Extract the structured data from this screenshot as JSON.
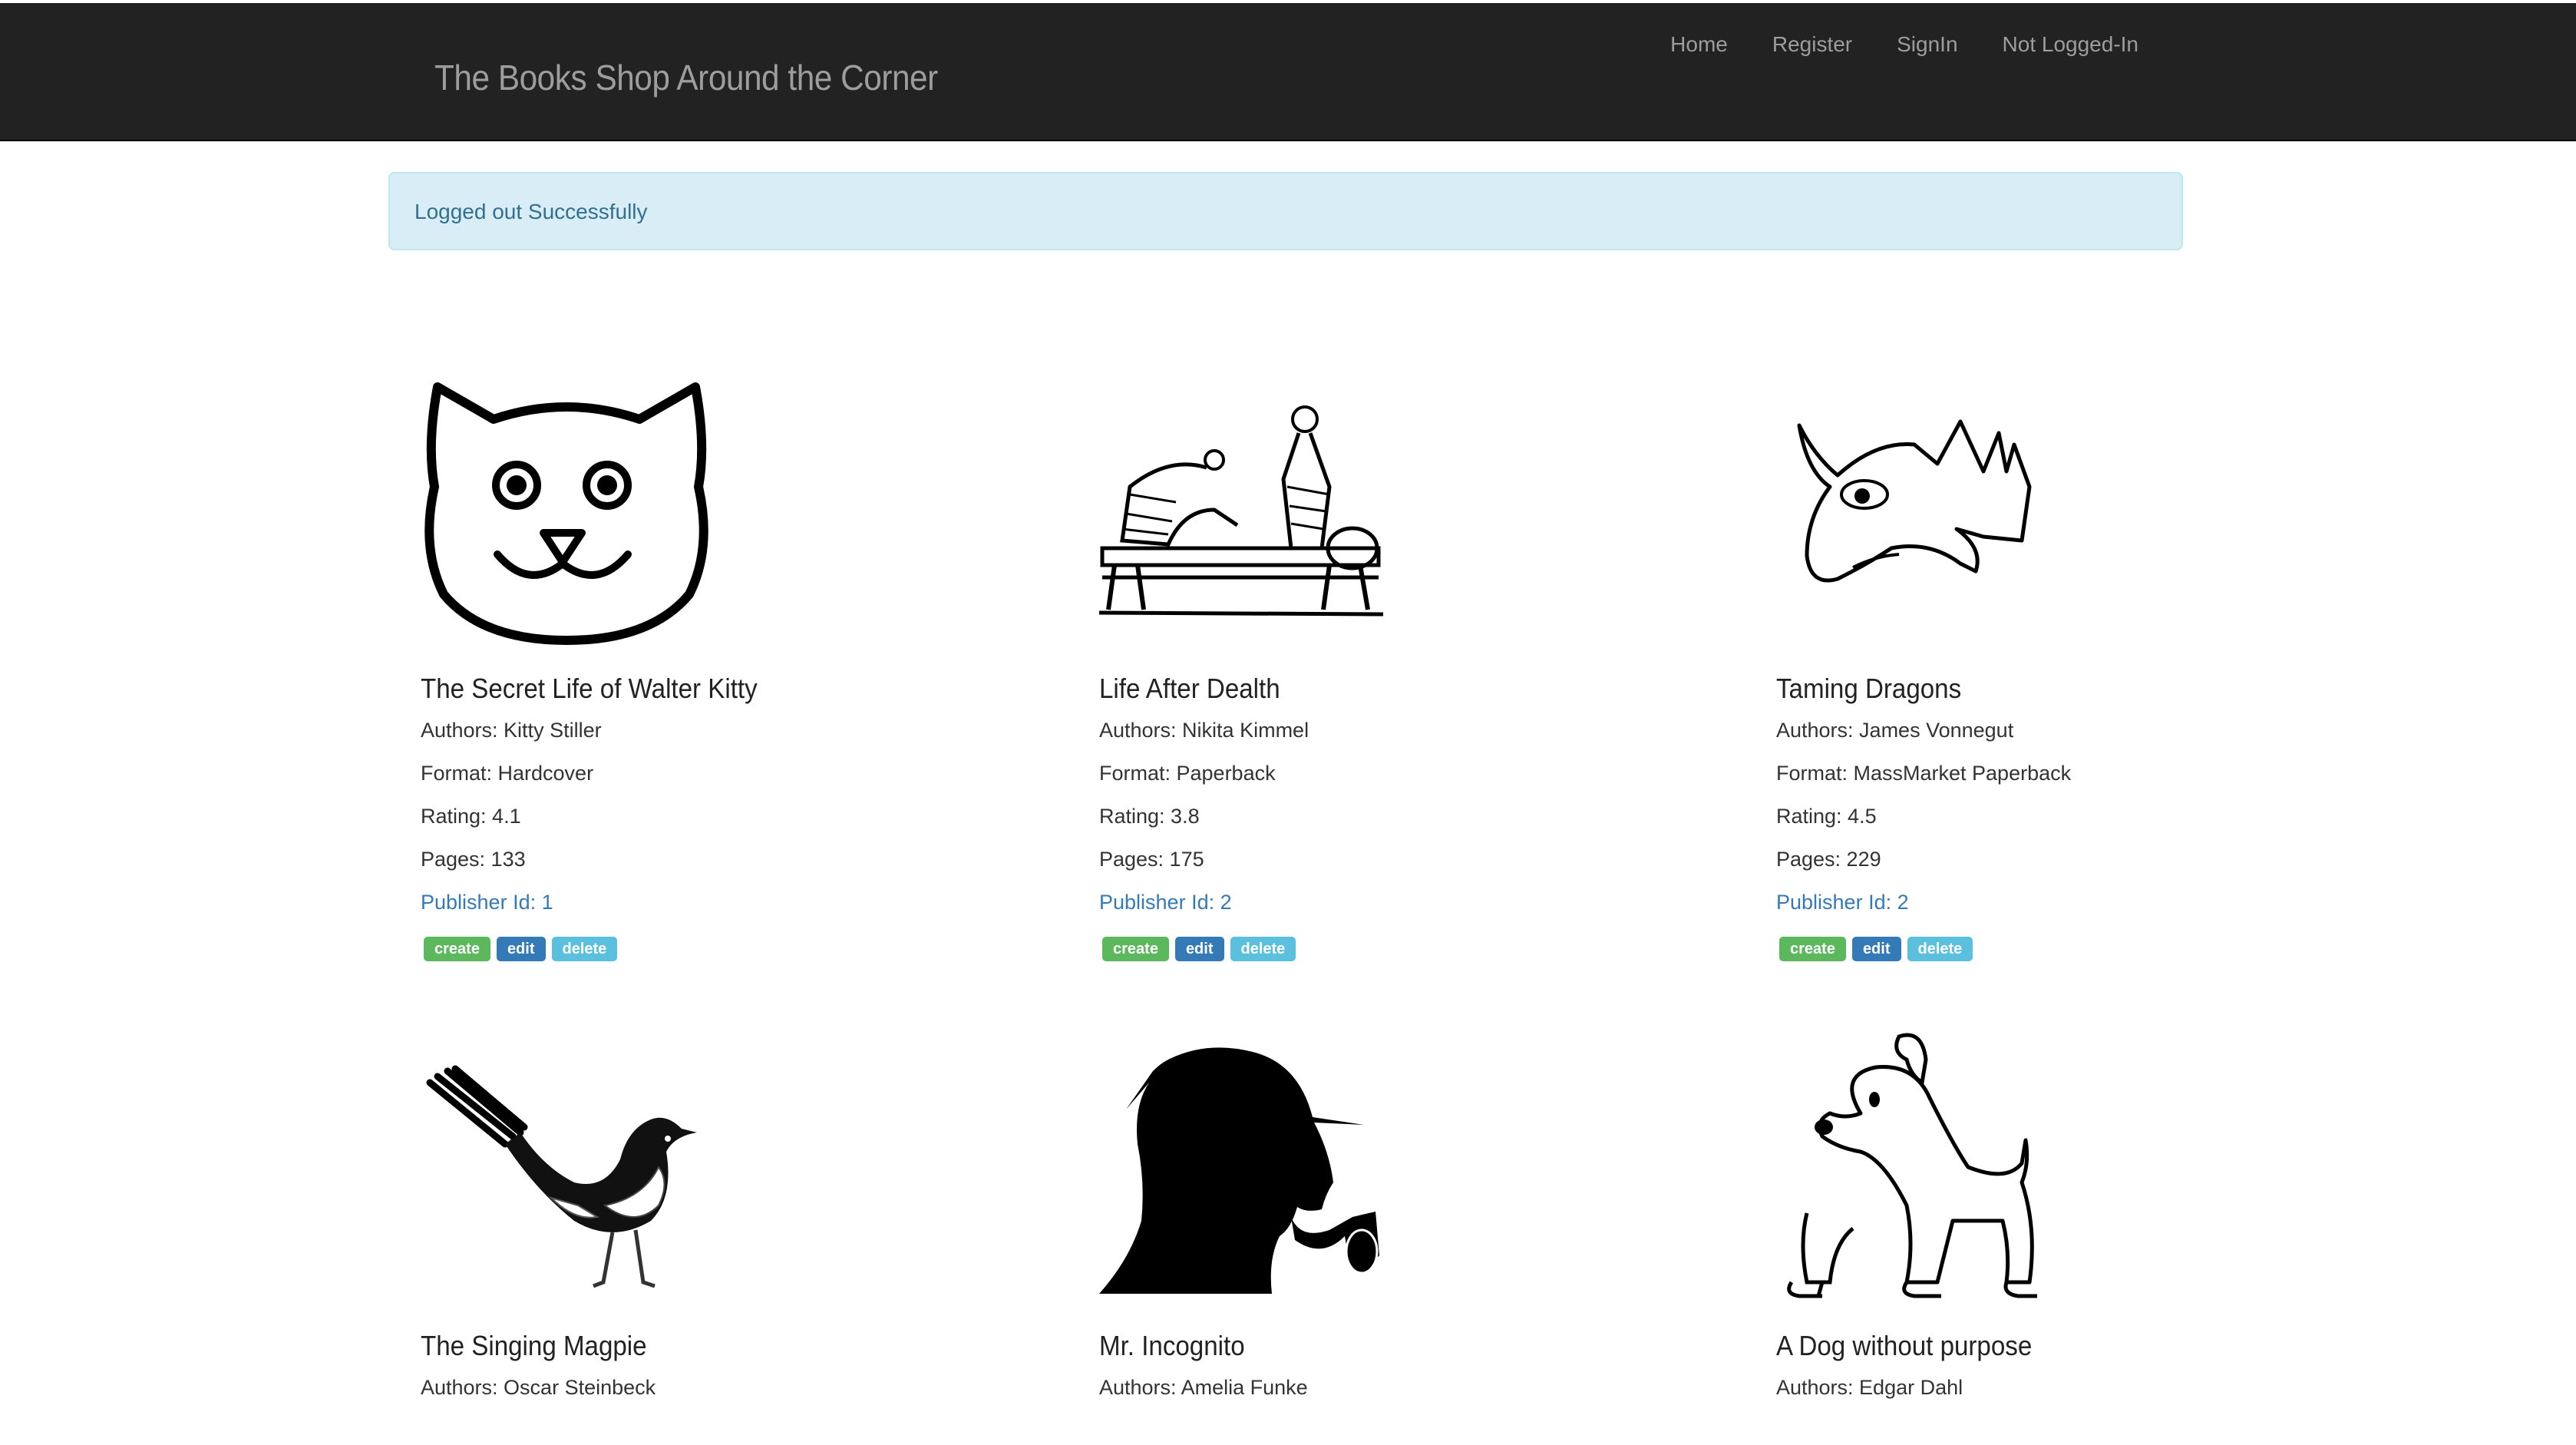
{
  "header": {
    "brand": "The Books Shop Around the Corner",
    "nav": [
      "Home",
      "Register",
      "SignIn",
      "Not Logged-In"
    ]
  },
  "alert": {
    "message": "Logged out Successfully"
  },
  "actions": {
    "create": "create",
    "edit": "edit",
    "delete": "delete"
  },
  "books": [
    {
      "title": "The Secret Life of Walter Kitty",
      "authors": "Authors: Kitty Stiller",
      "format": "Format: Hardcover",
      "rating": "Rating: 4.1",
      "pages": "Pages: 133",
      "publisher": "Publisher Id: 1",
      "image": "cat-icon"
    },
    {
      "title": "Life After Dealth",
      "authors": "Authors: Nikita Kimmel",
      "format": "Format: Paperback",
      "rating": "Rating: 3.8",
      "pages": "Pages: 175",
      "publisher": "Publisher Id: 2",
      "image": "egyptian-embalming-icon"
    },
    {
      "title": "Taming Dragons",
      "authors": "Authors: James Vonnegut",
      "format": "Format: MassMarket Paperback",
      "rating": "Rating: 4.5",
      "pages": "Pages: 229",
      "publisher": "Publisher Id: 2",
      "image": "dragon-icon"
    },
    {
      "title": "The Singing Magpie",
      "authors": "Authors: Oscar Steinbeck",
      "image": "magpie-icon"
    },
    {
      "title": "Mr. Incognito",
      "authors": "Authors: Amelia Funke",
      "image": "detective-silhouette-icon"
    },
    {
      "title": "A Dog without purpose",
      "authors": "Authors: Edgar Dahl",
      "image": "dog-icon"
    }
  ]
}
